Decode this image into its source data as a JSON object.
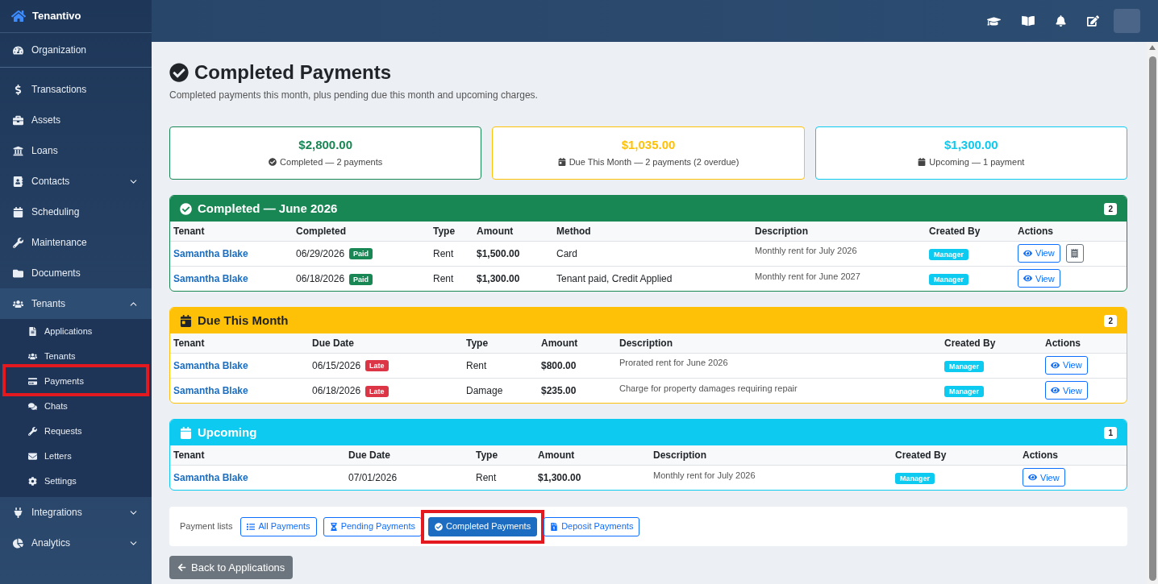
{
  "sidebar": {
    "brand": "Tenantivo",
    "organization": "Organization",
    "items": [
      {
        "kind": "link",
        "label": "Transactions"
      },
      {
        "kind": "link",
        "label": "Assets"
      },
      {
        "kind": "link",
        "label": "Loans"
      },
      {
        "kind": "group",
        "label": "Contacts",
        "expanded": false
      },
      {
        "kind": "link",
        "label": "Scheduling"
      },
      {
        "kind": "link",
        "label": "Maintenance"
      },
      {
        "kind": "link",
        "label": "Documents"
      },
      {
        "kind": "group",
        "label": "Tenants",
        "expanded": true,
        "children": [
          {
            "label": "Applications",
            "highlighted": false
          },
          {
            "label": "Tenants",
            "highlighted": false
          },
          {
            "label": "Payments",
            "highlighted": true
          },
          {
            "label": "Chats",
            "highlighted": false
          },
          {
            "label": "Requests",
            "highlighted": false
          },
          {
            "label": "Letters",
            "highlighted": false
          },
          {
            "label": "Settings",
            "highlighted": false
          }
        ]
      },
      {
        "kind": "group",
        "label": "Integrations",
        "expanded": false
      },
      {
        "kind": "group",
        "label": "Analytics",
        "expanded": false
      }
    ]
  },
  "page": {
    "title": "Completed Payments",
    "subtitle": "Completed payments this month, plus pending due this month and upcoming charges."
  },
  "summary_cards": [
    {
      "amount": "$2,800.00",
      "label": "Completed — 2 payments",
      "color": "#198754"
    },
    {
      "amount": "$1,035.00",
      "label": "Due This Month — 2 payments (2 overdue)",
      "color": "#ffc107"
    },
    {
      "amount": "$1,300.00",
      "label": "Upcoming — 1 payment",
      "color": "#0dcaf0"
    }
  ],
  "sections": [
    {
      "title": "Completed — June 2026",
      "count": "2",
      "color": "#198754",
      "columns": [
        "Tenant",
        "Completed",
        "Type",
        "Amount",
        "Method",
        "Description",
        "Created By",
        "Actions"
      ],
      "rows": [
        {
          "cells": [
            {
              "kind": "tenant",
              "text": "Samantha Blake"
            },
            {
              "kind": "date",
              "text": "06/29/2026",
              "badge": "Paid",
              "color": "#198754"
            },
            {
              "kind": "text",
              "text": "Rent"
            },
            {
              "kind": "amount",
              "text": "$1,500.00"
            },
            {
              "kind": "text",
              "text": "Card"
            },
            {
              "kind": "note",
              "text": "Monthly rent for July 2026"
            },
            {
              "kind": "role",
              "text": "Manager"
            },
            {
              "kind": "actions",
              "label": "View",
              "receipt": true
            }
          ]
        },
        {
          "cells": [
            {
              "kind": "tenant",
              "text": "Samantha Blake"
            },
            {
              "kind": "date",
              "text": "06/18/2026",
              "badge": "Paid",
              "color": "#198754"
            },
            {
              "kind": "text",
              "text": "Rent"
            },
            {
              "kind": "amount",
              "text": "$1,300.00"
            },
            {
              "kind": "text",
              "text": "Tenant paid, Credit Applied"
            },
            {
              "kind": "note",
              "text": "Monthly rent for June 2027"
            },
            {
              "kind": "role",
              "text": "Manager"
            },
            {
              "kind": "actions",
              "label": "View",
              "receipt": false
            }
          ]
        }
      ]
    },
    {
      "title": "Due This Month",
      "count": "2",
      "color": "#ffc107",
      "columns": [
        "Tenant",
        "Due Date",
        "Type",
        "Amount",
        "Description",
        "Created By",
        "Actions"
      ],
      "rows": [
        {
          "cells": [
            {
              "kind": "tenant",
              "text": "Samantha Blake"
            },
            {
              "kind": "date",
              "text": "06/15/2026",
              "badge": "Late",
              "color": "#dc3545"
            },
            {
              "kind": "text",
              "text": "Rent"
            },
            {
              "kind": "amount",
              "text": "$800.00"
            },
            {
              "kind": "note",
              "text": "Prorated rent for June 2026"
            },
            {
              "kind": "role",
              "text": "Manager"
            },
            {
              "kind": "actions",
              "label": "View",
              "receipt": false
            }
          ]
        },
        {
          "cells": [
            {
              "kind": "tenant",
              "text": "Samantha Blake"
            },
            {
              "kind": "date",
              "text": "06/18/2026",
              "badge": "Late",
              "color": "#dc3545"
            },
            {
              "kind": "text",
              "text": "Damage"
            },
            {
              "kind": "amount",
              "text": "$235.00"
            },
            {
              "kind": "note",
              "text": "Charge for property damages requiring repair"
            },
            {
              "kind": "role",
              "text": "Manager"
            },
            {
              "kind": "actions",
              "label": "View",
              "receipt": false
            }
          ]
        }
      ]
    },
    {
      "title": "Upcoming",
      "count": "1",
      "color": "#0dcaf0",
      "columns": [
        "Tenant",
        "Due Date",
        "Type",
        "Amount",
        "Description",
        "Created By",
        "Actions"
      ],
      "rows": [
        {
          "cells": [
            {
              "kind": "tenant",
              "text": "Samantha Blake"
            },
            {
              "kind": "text",
              "text": "07/01/2026"
            },
            {
              "kind": "text",
              "text": "Rent"
            },
            {
              "kind": "amount",
              "text": "$1,300.00"
            },
            {
              "kind": "note",
              "text": "Monthly rent for July 2026"
            },
            {
              "kind": "role",
              "text": "Manager"
            },
            {
              "kind": "actions",
              "label": "View",
              "receipt": false
            }
          ]
        }
      ]
    }
  ],
  "payment_lists": {
    "label": "Payment lists",
    "buttons": [
      {
        "label": "All Payments",
        "selected": false,
        "highlighted": false
      },
      {
        "label": "Pending Payments",
        "selected": false,
        "highlighted": false
      },
      {
        "label": "Completed Payments",
        "selected": true,
        "highlighted": true
      },
      {
        "label": "Deposit Payments",
        "selected": false,
        "highlighted": false
      }
    ]
  },
  "back_button": "Back to Applications"
}
